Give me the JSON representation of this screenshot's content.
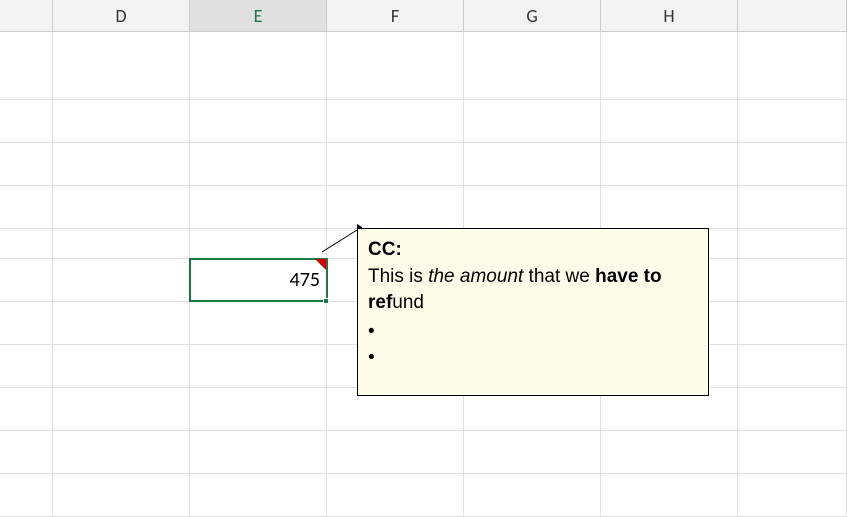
{
  "columns": {
    "d": "D",
    "e": "E",
    "f": "F",
    "g": "G",
    "h": "H"
  },
  "active_cell": {
    "ref": "E",
    "value": "475"
  },
  "comment": {
    "author": "CC:",
    "text_before_italic": "This is ",
    "italic": "the amount",
    "text_after_italic": " that we ",
    "bold": "have to ref",
    "text_after_bold": "und",
    "bullets": [
      "•",
      "•"
    ]
  }
}
